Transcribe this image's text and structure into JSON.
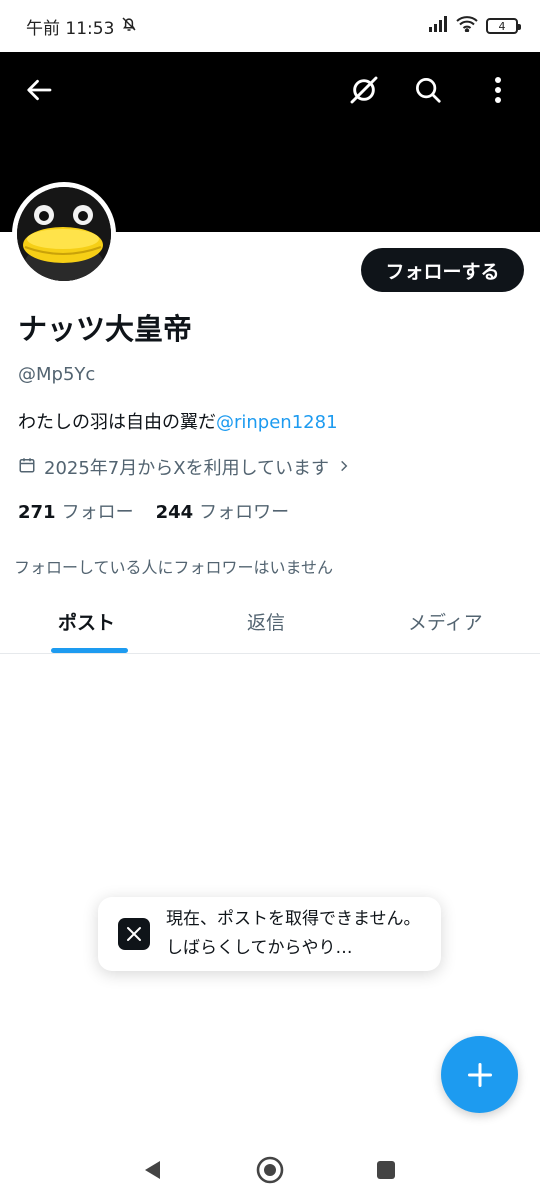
{
  "status_bar": {
    "time": "午前 11:53",
    "battery": "4"
  },
  "header": {
    "back_icon": "arrow-left-icon",
    "grok_icon": "grok-icon",
    "search_icon": "search-icon",
    "more_icon": "more-vertical-icon",
    "background": "#000000"
  },
  "profile": {
    "avatar_icon": "penguin-avatar",
    "follow_button": "フォローする",
    "name": "ナッツ大皇帝",
    "handle": "@Mp5Yc",
    "bio_text": "わたしの羽は自由の翼だ",
    "bio_mention": "@rinpen1281",
    "joined": "2025年7月からXを利用しています",
    "following_count": "271",
    "following_label": "フォロー",
    "followers_count": "244",
    "followers_label": "フォロワー",
    "mutual_note": "フォローしている人にフォロワーはいません"
  },
  "tabs": [
    {
      "label": "ポスト",
      "active": true
    },
    {
      "label": "返信",
      "active": false
    },
    {
      "label": "メディア",
      "active": false
    }
  ],
  "toast": {
    "text": "現在、ポストを取得できません。しばらくしてからやり…",
    "icon": "x-logo-icon"
  },
  "fab": {
    "icon": "plus-icon"
  },
  "colors": {
    "accent": "#1d9bf0",
    "text": "#0f1419",
    "secondary": "#536471"
  }
}
